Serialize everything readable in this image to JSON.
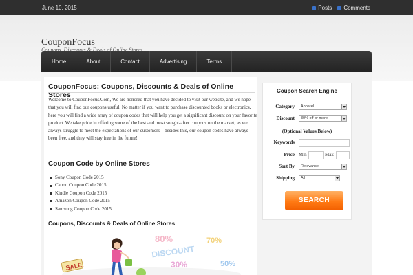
{
  "topbar": {
    "date": "June 10, 2015",
    "posts_label": "Posts",
    "comments_label": "Comments"
  },
  "site": {
    "title": "CouponFocus",
    "description": "Coupons, Discounts & Deals of Online Stores"
  },
  "nav": {
    "items": [
      "Home",
      "About",
      "Contact",
      "Advertising",
      "Terms"
    ]
  },
  "main": {
    "title": "CouponFocus: Coupons, Discounts & Deals of Online Stores",
    "welcome": "Welcome to CouponFocus.Com, We are honored that you have decided to visit our website, and we hope that you will find our coupons useful. No matter if you want to purchase discounted books or electronics, here you will find a wide array of coupon codes that will help you get a significant discount on your favorite product. We take pride in offering some of the best and most sought-after coupons on the market, as we always struggle to meet the expectations of our customers – besides this, our coupon codes have always been free, and they will stay free in the future!",
    "code_title": "Coupon Code by Online Stores",
    "stores": [
      "Sony Coupon Code 2015",
      "Canon Coupon Code 2015",
      "Kindle Coupon Code 2015",
      "Amazon Coupon Code 2015",
      "Samsung Coupon Code 2015"
    ],
    "deals_title": "Coupons, Discounts & Deals of Online Stores",
    "banner": {
      "sale": "SALE",
      "pct80": "80%",
      "discount": "DISCOUNT",
      "pct70": "70%",
      "pct30": "30%",
      "pct50": "50%"
    }
  },
  "sidebar": {
    "title": "Coupon Search Engine",
    "category_label": "Category",
    "category_value": "Apparel",
    "discount_label": "Discount",
    "discount_value": "30% off or more",
    "optional_label": "(Optional Values Below)",
    "keywords_label": "Keywords",
    "price_label": "Price",
    "min_label": "Min",
    "max_label": "Max",
    "sortby_label": "Sort By",
    "sortby_value": "Relevance",
    "shipping_label": "Shipping",
    "shipping_value": "All",
    "search_label": "SEARCH"
  },
  "colors": {
    "nav_bg": "#2b2b2b",
    "search_button": "#ff7a14",
    "topbar_bg": "#2f2f2f"
  }
}
